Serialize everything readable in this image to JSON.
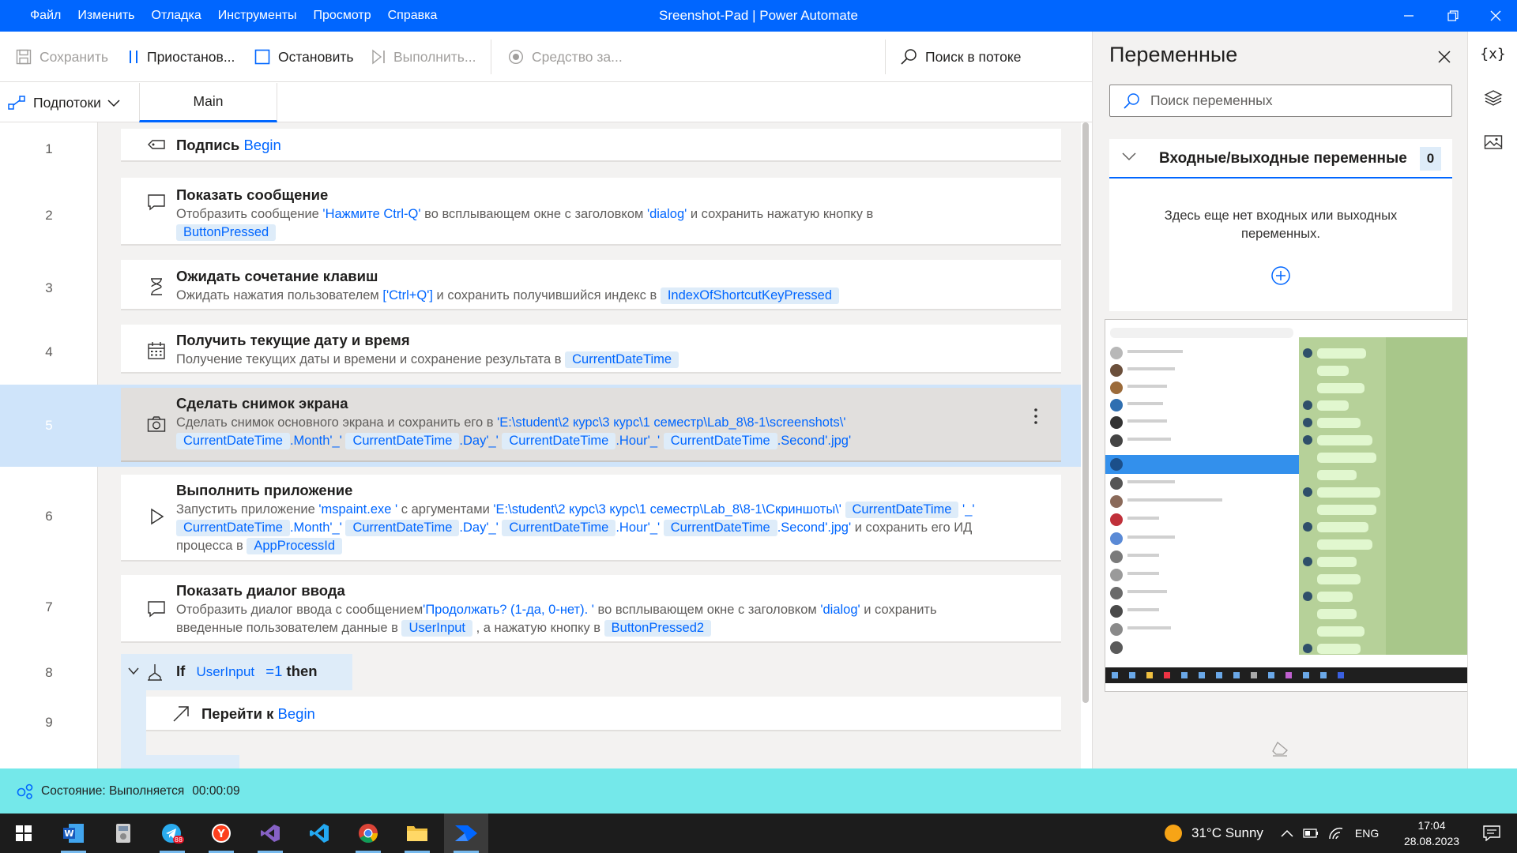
{
  "titlebar": {
    "menu": [
      "Файл",
      "Изменить",
      "Отладка",
      "Инструменты",
      "Просмотр",
      "Справка"
    ],
    "title": "Sreenshot-Pad | Power Automate"
  },
  "toolbar": {
    "save": "Сохранить",
    "pause": "Приостанов...",
    "stop": "Остановить",
    "run_next": "Выполнить...",
    "recorder": "Средство за...",
    "search": "Поиск в потоке"
  },
  "tabs": {
    "subflows": "Подпотоки",
    "main": "Main"
  },
  "flow": {
    "line_numbers": [
      "1",
      "2",
      "3",
      "4",
      "5",
      "6",
      "7",
      "8",
      "9"
    ],
    "a1": {
      "title": "Подпись",
      "label": "Begin"
    },
    "a2": {
      "title": "Показать сообщение",
      "d1": "Отобразить сообщение ",
      "s1": "'Нажмите Ctrl-Q'",
      "d2": " во всплывающем окне с заголовком ",
      "s2": "'dialog'",
      "d3": " и сохранить нажатую кнопку в",
      "v1": "ButtonPressed"
    },
    "a3": {
      "title": "Ожидать сочетание клавиш",
      "d1": "Ожидать нажатия пользователем ",
      "s1": "['Ctrl+Q']",
      "d2": " и сохранить получившийся индекс в ",
      "v1": "IndexOfShortcutKeyPressed"
    },
    "a4": {
      "title": "Получить текущие дату и время",
      "d1": "Получение текущих даты и времени и сохранение результата в ",
      "v1": "CurrentDateTime"
    },
    "a5": {
      "title": "Сделать снимок экрана",
      "d1": "Сделать снимок основного экрана и сохранить его в ",
      "s1": "'E:\\student\\2 курс\\3 курс\\1 семестр\\Lab_8\\8-1\\screenshots\\'",
      "v1": "CurrentDateTime",
      "s2": ".Month'_'",
      "v2": "CurrentDateTime",
      "s3": ".Day'_'",
      "v3": "CurrentDateTime",
      "s4": ".Hour'_'",
      "v4": "CurrentDateTime",
      "s5": ".Second'.jpg'"
    },
    "a6": {
      "title": "Выполнить приложение",
      "d1": "Запустить приложение ",
      "s1": "'mspaint.exe '",
      "d2": " с аргументами ",
      "s2": "'E:\\student\\2 курс\\3 курс\\1 семестр\\Lab_8\\8-1\\Скриншоты\\'",
      "v1": "CurrentDateTime",
      "s3": "'_'",
      "v2": "CurrentDateTime",
      "s4": ".Month'_'",
      "v3": "CurrentDateTime",
      "s5": ".Day'_'",
      "v4": "CurrentDateTime",
      "s6": ".Hour'_'",
      "v5": "CurrentDateTime",
      "s7": ".Second'.jpg'",
      "d3": " и сохранить его ИД",
      "d4": "процесса в ",
      "v6": "AppProcessId"
    },
    "a7": {
      "title": "Показать диалог ввода",
      "d1": "Отобразить диалог ввода с сообщением",
      "s1": "'Продолжать? (1-да, 0-нет). '",
      "d2": " во всплывающем окне с заголовком ",
      "s2": "'dialog'",
      "d3": " и сохранить",
      "d4": "введенные пользователем данные в ",
      "v1": "UserInput",
      "d5": " , а нажатую кнопку в ",
      "v2": "ButtonPressed2"
    },
    "a8": {
      "keyword_if": "If",
      "v1": "UserInput",
      "cond": "=1",
      "keyword_then": "then"
    },
    "a9": {
      "title": "Перейти к",
      "label": "Begin"
    }
  },
  "variables": {
    "title": "Переменные",
    "search_placeholder": "Поиск переменных",
    "io_title": "Входные/выходные переменные",
    "io_count": "0",
    "io_empty": "Здесь еще нет входных или выходных переменных."
  },
  "rail": {
    "vars_symbol": "{x}"
  },
  "status": {
    "label": "Состояние: Выполняется",
    "elapsed": "00:00:09"
  },
  "taskbar": {
    "weather": "31°C  Sunny",
    "lang": "ENG",
    "time": "17:04",
    "date": "28.08.2023",
    "telegram_badge": "88"
  },
  "colors": {
    "accent": "#0066ff",
    "status_bg": "#74e8ea",
    "var_bg": "#deecf9",
    "selected_band": "#cfe4fa"
  }
}
